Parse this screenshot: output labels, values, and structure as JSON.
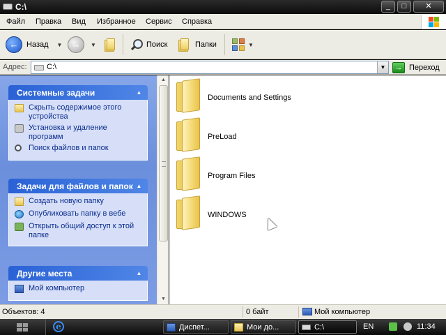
{
  "window": {
    "title": "C:\\",
    "buttons": {
      "minimize": "_",
      "maximize": "□",
      "close": "✕"
    }
  },
  "menu": [
    "Файл",
    "Правка",
    "Вид",
    "Избранное",
    "Сервис",
    "Справка"
  ],
  "toolbar": {
    "back_label": "Назад",
    "search_label": "Поиск",
    "folders_label": "Папки"
  },
  "address": {
    "label": "Адрес:",
    "value": "C:\\",
    "go_label": "Переход"
  },
  "tasks": {
    "system": {
      "title": "Системные задачи",
      "items": [
        {
          "label": "Скрыть содержимое этого устройства",
          "icon": "folder-hide-icon"
        },
        {
          "label": "Установка и удаление программ",
          "icon": "add-remove-icon"
        },
        {
          "label": "Поиск файлов и папок",
          "icon": "search-icon"
        }
      ]
    },
    "files": {
      "title": "Задачи для файлов и папок",
      "items": [
        {
          "label": "Создать новую папку",
          "icon": "new-folder-icon"
        },
        {
          "label": "Опубликовать папку в вебе",
          "icon": "globe-icon"
        },
        {
          "label": "Открыть общий доступ к этой папке",
          "icon": "share-icon"
        }
      ]
    },
    "other": {
      "title": "Другие места",
      "items": [
        {
          "label": "Мой компьютер",
          "icon": "computer-icon"
        }
      ]
    }
  },
  "files": [
    {
      "name": "Documents and Settings"
    },
    {
      "name": "PreLoad"
    },
    {
      "name": "Program Files"
    },
    {
      "name": "WINDOWS"
    }
  ],
  "status": {
    "objects": "Объектов: 4",
    "size": "0 байт",
    "location": "Мой компьютер"
  },
  "taskbar": {
    "tasks": [
      "Диспет...",
      "Мои до...",
      "C:\\"
    ],
    "language": "EN",
    "clock": "11:34"
  },
  "colors": {
    "link": "#0b2c8e",
    "pane_header": "#2a62d6",
    "pane_background": "#7c9ce4"
  }
}
